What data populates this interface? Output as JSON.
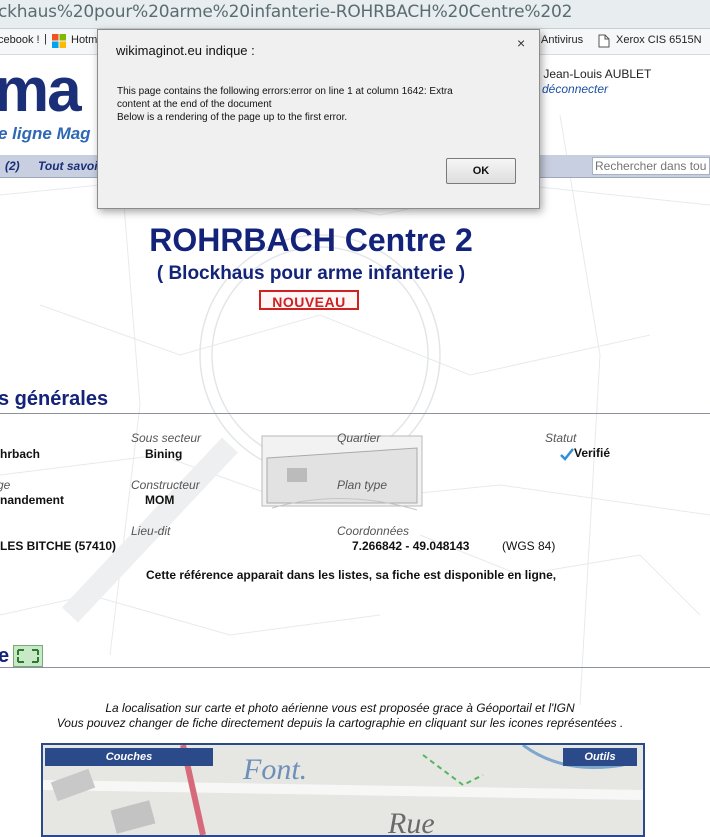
{
  "browser": {
    "url": "ckhaus%20pour%20arme%20infanterie-ROHRBACH%20Centre%202",
    "bookmarks": [
      "cebook !",
      "Hotm",
      "Antivirus",
      "Xerox CIS 6515N"
    ]
  },
  "header": {
    "logo_text": "ma",
    "logo_subtitle": "e ligne Mag",
    "user_name": "r Jean-Louis AUBLET",
    "logout_label": "déconnecter",
    "nav_items": [
      "(2)",
      "Tout savoi"
    ],
    "search_placeholder": "Rechercher dans tou"
  },
  "main": {
    "title": "ROHRBACH Centre 2",
    "subtitle": "( Blockhaus pour arme infanterie )",
    "badge": "NOUVEAU",
    "section_general": "s générales",
    "fields": {
      "row1": {
        "col1_label": "",
        "col1_value": "hrbach",
        "sous_secteur_label": "Sous secteur",
        "sous_secteur_value": "Bining",
        "quartier_label": "Quartier",
        "statut_label": "Statut",
        "statut_value": "Verifié"
      },
      "row2": {
        "col1_label": "ge",
        "col1_value": "nandement",
        "constructeur_label": "Constructeur",
        "constructeur_value": "MOM",
        "plan_type_label": "Plan type"
      },
      "row3": {
        "col1_value": "LES BITCHE (57410)",
        "lieu_dit_label": "Lieu-dit",
        "coordonnees_label": "Coordonnées",
        "coordonnees_value": "7.266842 - 49.048143",
        "coordonnees_system": "(WGS 84)"
      }
    },
    "availability_note": "Cette référence apparait dans les listes, sa fiche est disponible en ligne,",
    "section_map": "e",
    "map_note_1": "La localisation sur carte et photo aérienne vous est proposée grace à Géoportail et l'IGN",
    "map_note_2": "Vous pouvez changer de fiche directement depuis la cartographie en cliquant sur les icones représentées .",
    "map_tab_left": "Couches",
    "map_tab_right": "Outils",
    "map_label_font": "Font.",
    "map_label_rue": "Rue"
  },
  "dialog": {
    "title": "wikimaginot.eu indique :",
    "close_label": "×",
    "message_line1": "This page contains the following errors:error on line 1 at column 1642: Extra",
    "message_line2": "content at the end of the document",
    "message_line3": "Below is a rendering of the page up to the first error.",
    "ok_label": "OK"
  }
}
